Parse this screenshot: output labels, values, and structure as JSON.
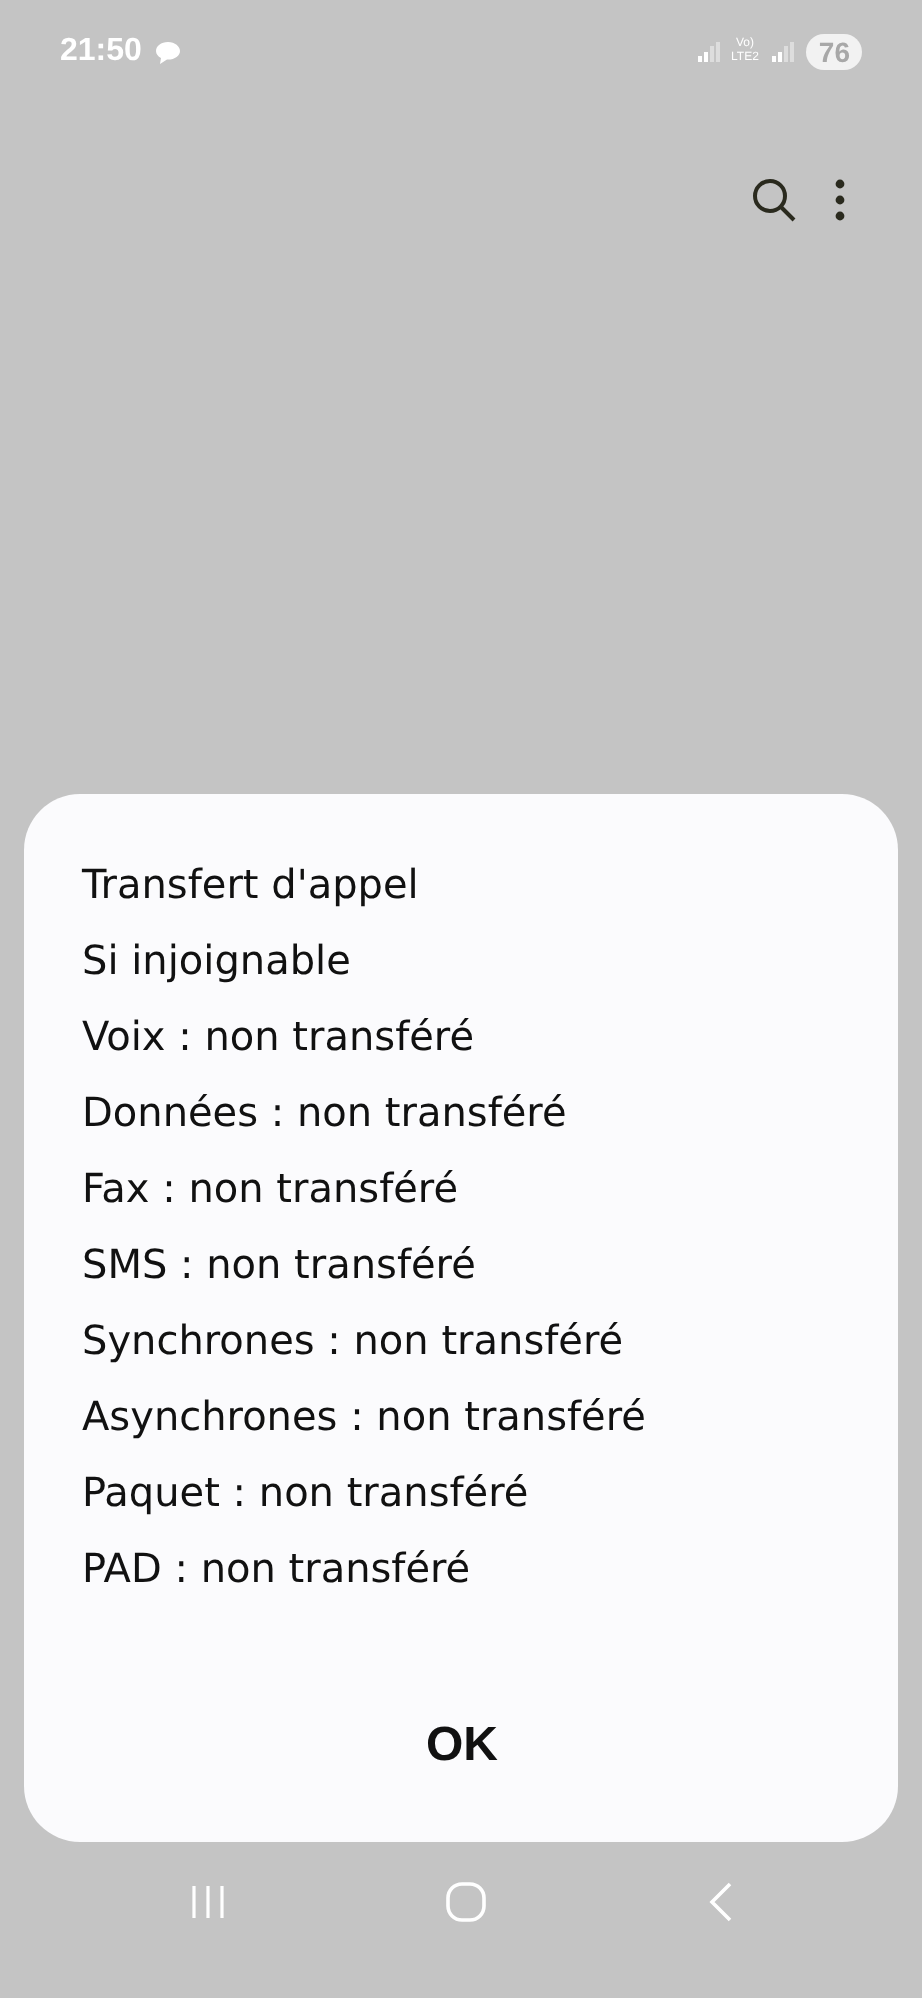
{
  "status_bar": {
    "time": "21:50",
    "network_lines": [
      "Vo)",
      "LTE2"
    ],
    "battery": "76"
  },
  "dialog": {
    "lines": [
      "Transfert d'appel",
      "Si injoignable",
      "Voix : non transféré",
      "Données : non transféré",
      "Fax : non transféré",
      "SMS : non transféré",
      "Synchrones : non transféré",
      "Asynchrones : non transféré",
      "Paquet : non transféré",
      "PAD : non transféré"
    ],
    "button": "OK"
  }
}
